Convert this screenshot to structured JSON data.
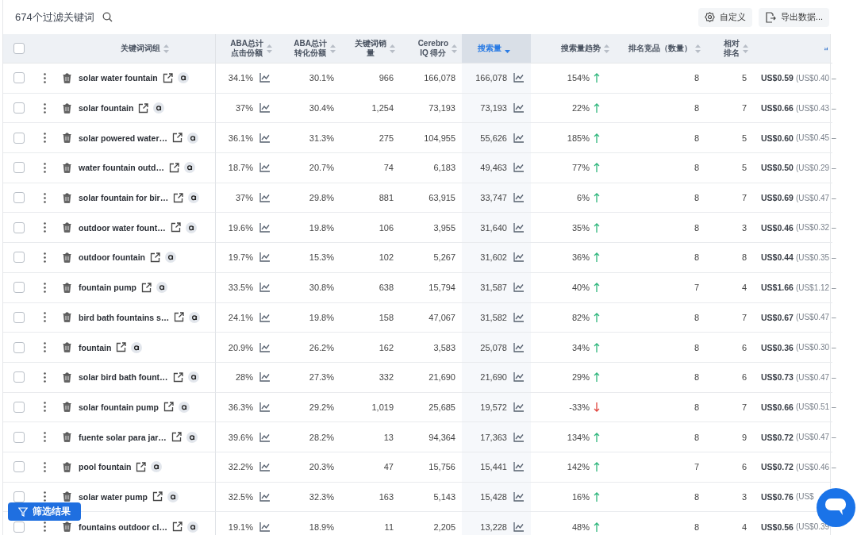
{
  "toolbar": {
    "title": "674个过滤关键词",
    "buttons": [
      {
        "kind": "customize",
        "label": "自定义"
      },
      {
        "kind": "export",
        "label": "导出数据..."
      }
    ]
  },
  "table": {
    "all_checked": false,
    "columns": [
      {
        "lines": [
          "关键词词组"
        ],
        "sorted": false,
        "selected": false
      },
      {
        "lines": [
          "ABA总计",
          "点击份额"
        ],
        "sorted": false,
        "selected": false
      },
      {
        "lines": [
          "ABA总计",
          "转化份额"
        ],
        "sorted": false,
        "selected": false
      },
      {
        "lines": [
          "关键词销",
          "量"
        ],
        "sorted": false,
        "selected": false
      },
      {
        "lines": [
          "Cerebro",
          "IQ 得分"
        ],
        "sorted": false,
        "selected": false
      },
      {
        "lines": [
          "搜索量"
        ],
        "sorted": true,
        "selected": true
      },
      {
        "lines": [
          "搜索量趋势"
        ],
        "sorted": false,
        "selected": false
      },
      {
        "lines": [
          "排名竞品（数量）"
        ],
        "sorted": false,
        "selected": false
      },
      {
        "lines": [
          "相对",
          "排名"
        ],
        "sorted": false,
        "selected": false
      }
    ],
    "rows": [
      {
        "checked": false,
        "keyword": "solar water fountain",
        "click_share": "34.1%",
        "conversion_share": "30.1%",
        "sales": "966",
        "cerebro_iq": "166,078",
        "search_volume": "166,078",
        "trend": "154%",
        "rising": true,
        "competitors": "8",
        "relative_rank": "5",
        "price": "US$0.59",
        "price_range": "(US$0.40 –"
      },
      {
        "checked": false,
        "keyword": "solar fountain",
        "click_share": "37%",
        "conversion_share": "30.4%",
        "sales": "1,254",
        "cerebro_iq": "73,193",
        "search_volume": "73,193",
        "trend": "22%",
        "rising": true,
        "competitors": "8",
        "relative_rank": "7",
        "price": "US$0.66",
        "price_range": "(US$0.43 –"
      },
      {
        "checked": false,
        "keyword": "solar powered water…",
        "click_share": "36.1%",
        "conversion_share": "31.3%",
        "sales": "275",
        "cerebro_iq": "104,955",
        "search_volume": "55,626",
        "trend": "185%",
        "rising": true,
        "competitors": "8",
        "relative_rank": "5",
        "price": "US$0.60",
        "price_range": "(US$0.45 –"
      },
      {
        "checked": false,
        "keyword": "water fountain outd…",
        "click_share": "18.7%",
        "conversion_share": "20.7%",
        "sales": "74",
        "cerebro_iq": "6,183",
        "search_volume": "49,463",
        "trend": "77%",
        "rising": true,
        "competitors": "8",
        "relative_rank": "5",
        "price": "US$0.50",
        "price_range": "(US$0.29 –"
      },
      {
        "checked": false,
        "keyword": "solar fountain for bir…",
        "click_share": "37%",
        "conversion_share": "29.8%",
        "sales": "881",
        "cerebro_iq": "63,915",
        "search_volume": "33,747",
        "trend": "6%",
        "rising": true,
        "competitors": "8",
        "relative_rank": "7",
        "price": "US$0.69",
        "price_range": "(US$0.47 –"
      },
      {
        "checked": false,
        "keyword": "outdoor water fount…",
        "click_share": "19.6%",
        "conversion_share": "19.8%",
        "sales": "106",
        "cerebro_iq": "3,955",
        "search_volume": "31,640",
        "trend": "35%",
        "rising": true,
        "competitors": "8",
        "relative_rank": "3",
        "price": "US$0.46",
        "price_range": "(US$0.32 –"
      },
      {
        "checked": false,
        "keyword": "outdoor fountain",
        "click_share": "19.7%",
        "conversion_share": "15.3%",
        "sales": "102",
        "cerebro_iq": "5,267",
        "search_volume": "31,602",
        "trend": "36%",
        "rising": true,
        "competitors": "8",
        "relative_rank": "8",
        "price": "US$0.44",
        "price_range": "(US$0.35 –"
      },
      {
        "checked": false,
        "keyword": "fountain pump",
        "click_share": "33.5%",
        "conversion_share": "30.8%",
        "sales": "638",
        "cerebro_iq": "15,794",
        "search_volume": "31,587",
        "trend": "40%",
        "rising": true,
        "competitors": "7",
        "relative_rank": "4",
        "price": "US$1.66",
        "price_range": "(US$1.12 –"
      },
      {
        "checked": false,
        "keyword": "bird bath fountains s…",
        "click_share": "24.1%",
        "conversion_share": "19.8%",
        "sales": "158",
        "cerebro_iq": "47,067",
        "search_volume": "31,582",
        "trend": "82%",
        "rising": true,
        "competitors": "8",
        "relative_rank": "7",
        "price": "US$0.67",
        "price_range": "(US$0.47 –"
      },
      {
        "checked": false,
        "keyword": "fountain",
        "click_share": "20.9%",
        "conversion_share": "26.2%",
        "sales": "162",
        "cerebro_iq": "3,583",
        "search_volume": "25,078",
        "trend": "34%",
        "rising": true,
        "competitors": "8",
        "relative_rank": "6",
        "price": "US$0.36",
        "price_range": "(US$0.30 –"
      },
      {
        "checked": false,
        "keyword": "solar bird bath fount…",
        "click_share": "28%",
        "conversion_share": "27.3%",
        "sales": "332",
        "cerebro_iq": "21,690",
        "search_volume": "21,690",
        "trend": "29%",
        "rising": true,
        "competitors": "8",
        "relative_rank": "6",
        "price": "US$0.73",
        "price_range": "(US$0.47 –"
      },
      {
        "checked": false,
        "keyword": "solar fountain pump",
        "click_share": "36.3%",
        "conversion_share": "29.2%",
        "sales": "1,019",
        "cerebro_iq": "25,685",
        "search_volume": "19,572",
        "trend": "-33%",
        "rising": false,
        "competitors": "8",
        "relative_rank": "7",
        "price": "US$0.66",
        "price_range": "(US$0.51 –"
      },
      {
        "checked": false,
        "keyword": "fuente solar para jar…",
        "click_share": "39.6%",
        "conversion_share": "28.2%",
        "sales": "13",
        "cerebro_iq": "94,364",
        "search_volume": "17,363",
        "trend": "134%",
        "rising": true,
        "competitors": "8",
        "relative_rank": "9",
        "price": "US$0.72",
        "price_range": "(US$0.47 –"
      },
      {
        "checked": false,
        "keyword": "pool fountain",
        "click_share": "32.2%",
        "conversion_share": "20.3%",
        "sales": "47",
        "cerebro_iq": "15,756",
        "search_volume": "15,441",
        "trend": "142%",
        "rising": true,
        "competitors": "7",
        "relative_rank": "6",
        "price": "US$0.72",
        "price_range": "(US$0.46 –"
      },
      {
        "checked": false,
        "keyword": "solar water pump",
        "click_share": "32.5%",
        "conversion_share": "32.3%",
        "sales": "163",
        "cerebro_iq": "5,143",
        "search_volume": "15,428",
        "trend": "16%",
        "rising": true,
        "competitors": "8",
        "relative_rank": "3",
        "price": "US$0.76",
        "price_range": "(US$"
      },
      {
        "checked": false,
        "keyword": "fountains outdoor cl…",
        "click_share": "19.1%",
        "conversion_share": "18.9%",
        "sales": "11",
        "cerebro_iq": "2,205",
        "search_volume": "13,228",
        "trend": "48%",
        "rising": true,
        "competitors": "8",
        "relative_rank": "4",
        "price": "US$0.56",
        "price_range": "(US$0.39"
      }
    ]
  },
  "filter_button": {
    "label": "筛选结果"
  }
}
